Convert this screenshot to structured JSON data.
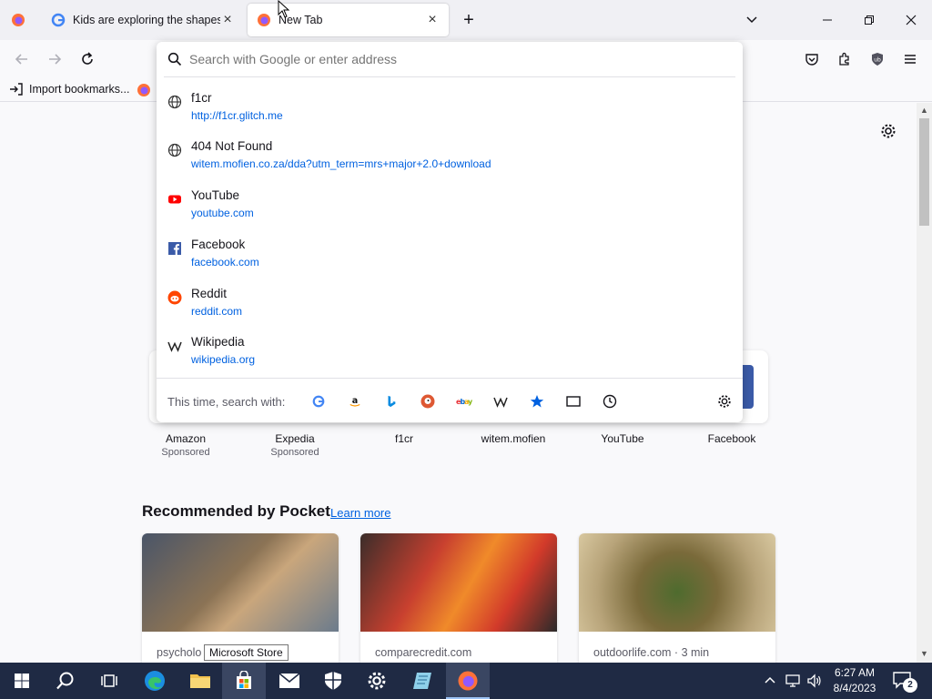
{
  "tabs": [
    {
      "title": "Kids are exploring the shapes and",
      "active": false
    },
    {
      "title": "New Tab",
      "active": true
    }
  ],
  "urlbar": {
    "placeholder": "Search with Google or enter address"
  },
  "bookmarks": {
    "import_label": "Import bookmarks..."
  },
  "suggestions": [
    {
      "title": "f1cr",
      "url": "http://f1cr.glitch.me",
      "icon": "globe-icon"
    },
    {
      "title": "404 Not Found",
      "url": "witem.mofien.co.za/dda?utm_term=mrs+major+2.0+download",
      "icon": "globe-icon"
    },
    {
      "title": "YouTube",
      "url": "youtube.com",
      "icon": "youtube-icon"
    },
    {
      "title": "Facebook",
      "url": "facebook.com",
      "icon": "facebook-icon"
    },
    {
      "title": "Reddit",
      "url": "reddit.com",
      "icon": "reddit-icon"
    },
    {
      "title": "Wikipedia",
      "url": "wikipedia.org",
      "icon": "wikipedia-icon"
    }
  ],
  "search_with": {
    "label": "This time, search with:"
  },
  "shortcuts": [
    {
      "label": "Amazon",
      "sub": "Sponsored"
    },
    {
      "label": "Expedia",
      "sub": "Sponsored"
    },
    {
      "label": "f1cr",
      "sub": ""
    },
    {
      "label": "witem.mofien",
      "sub": ""
    },
    {
      "label": "YouTube",
      "sub": ""
    },
    {
      "label": "Facebook",
      "sub": ""
    }
  ],
  "pocket": {
    "heading": "Recommended by Pocket",
    "learn_more": "Learn more",
    "cards": [
      {
        "source": "psycholo"
      },
      {
        "source": "comparecredit.com"
      },
      {
        "source": "outdoorlife.com · 3 min"
      }
    ]
  },
  "tooltip": {
    "text": "Microsoft Store"
  },
  "clock": {
    "time": "6:27 AM",
    "date": "8/4/2023"
  },
  "notifications": {
    "count": "2"
  },
  "colors": {
    "accent": "#0061e0",
    "taskbar": "#1f2a44"
  }
}
